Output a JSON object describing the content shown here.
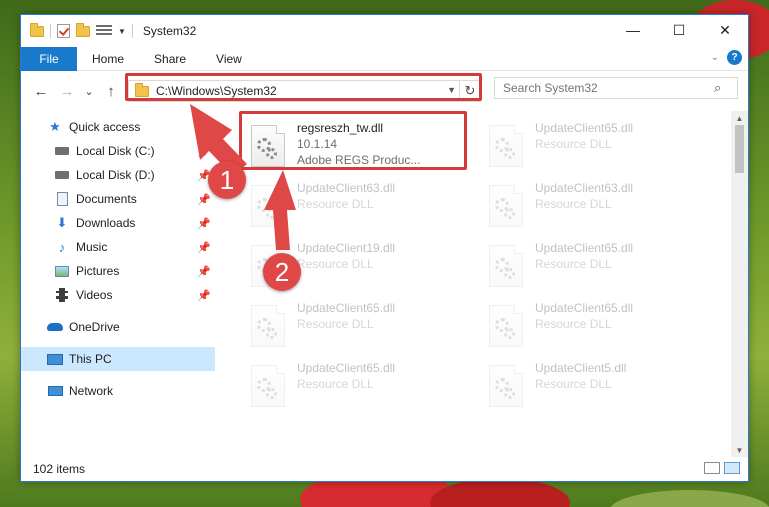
{
  "window": {
    "title": "System32",
    "minimize_icon": "minimize-icon",
    "maximize_icon": "maximize-icon",
    "close_icon": "close-icon"
  },
  "ribbon": {
    "tabs": [
      "File",
      "Home",
      "Share",
      "View"
    ],
    "help_symbol": "?"
  },
  "navigation": {
    "back_glyph": "←",
    "forward_glyph": "→",
    "recent_glyph": "⌄",
    "up_glyph": "↑"
  },
  "address_bar": {
    "path": "C:\\Windows\\System32",
    "refresh_glyph": "↻"
  },
  "search": {
    "placeholder": "Search System32"
  },
  "sidebar": {
    "items": [
      {
        "label": "Quick access",
        "icon": "star-icon",
        "pinned": false
      },
      {
        "label": "Local Disk (C:)",
        "icon": "drive-icon",
        "pinned": true
      },
      {
        "label": "Local Disk (D:)",
        "icon": "drive-icon",
        "pinned": true
      },
      {
        "label": "Documents",
        "icon": "documents-icon",
        "pinned": true
      },
      {
        "label": "Downloads",
        "icon": "download-icon",
        "pinned": true
      },
      {
        "label": "Music",
        "icon": "music-icon",
        "pinned": true
      },
      {
        "label": "Pictures",
        "icon": "pictures-icon",
        "pinned": true
      },
      {
        "label": "Videos",
        "icon": "video-icon",
        "pinned": true
      },
      {
        "label": "OneDrive",
        "icon": "cloud-icon",
        "pinned": false
      },
      {
        "label": "This PC",
        "icon": "computer-icon",
        "pinned": false,
        "selected": true
      },
      {
        "label": "Network",
        "icon": "network-icon",
        "pinned": false
      }
    ]
  },
  "files": [
    {
      "name": "regsreszh_tw.dll",
      "line2": "10.1.14",
      "line3": "Adobe REGS     Produc...",
      "highlighted": true
    },
    {
      "name": "UpdateClient65.dll",
      "line2": "Resource DLL",
      "faded": true
    },
    {
      "name": "UpdateClient63.dll",
      "line2": "Resource DLL",
      "faded": true
    },
    {
      "name": "UpdateClient63.dll",
      "line2": "Resource DLL",
      "faded": true
    },
    {
      "name": "UpdateClient19.dll",
      "line2": "Resource DLL",
      "faded": true
    },
    {
      "name": "UpdateClient65.dll",
      "line2": "Resource DLL",
      "faded": true
    },
    {
      "name": "UpdateClient65.dll",
      "line2": "Resource DLL",
      "faded": true
    },
    {
      "name": "UpdateClient65.dll",
      "line2": "Resource DLL",
      "faded": true
    },
    {
      "name": "UpdateClient65.dll",
      "line2": "Resource DLL",
      "faded": true
    },
    {
      "name": "UpdateClient5.dll",
      "line2": "Resource DLL",
      "faded": true
    }
  ],
  "status": {
    "item_count": "102 items"
  },
  "annotations": {
    "step1": "1",
    "step2": "2",
    "highlight_color": "#d33b3b",
    "arrow_color": "#e04848"
  },
  "colors": {
    "accent": "#1979ca",
    "selection": "#cce8ff"
  }
}
